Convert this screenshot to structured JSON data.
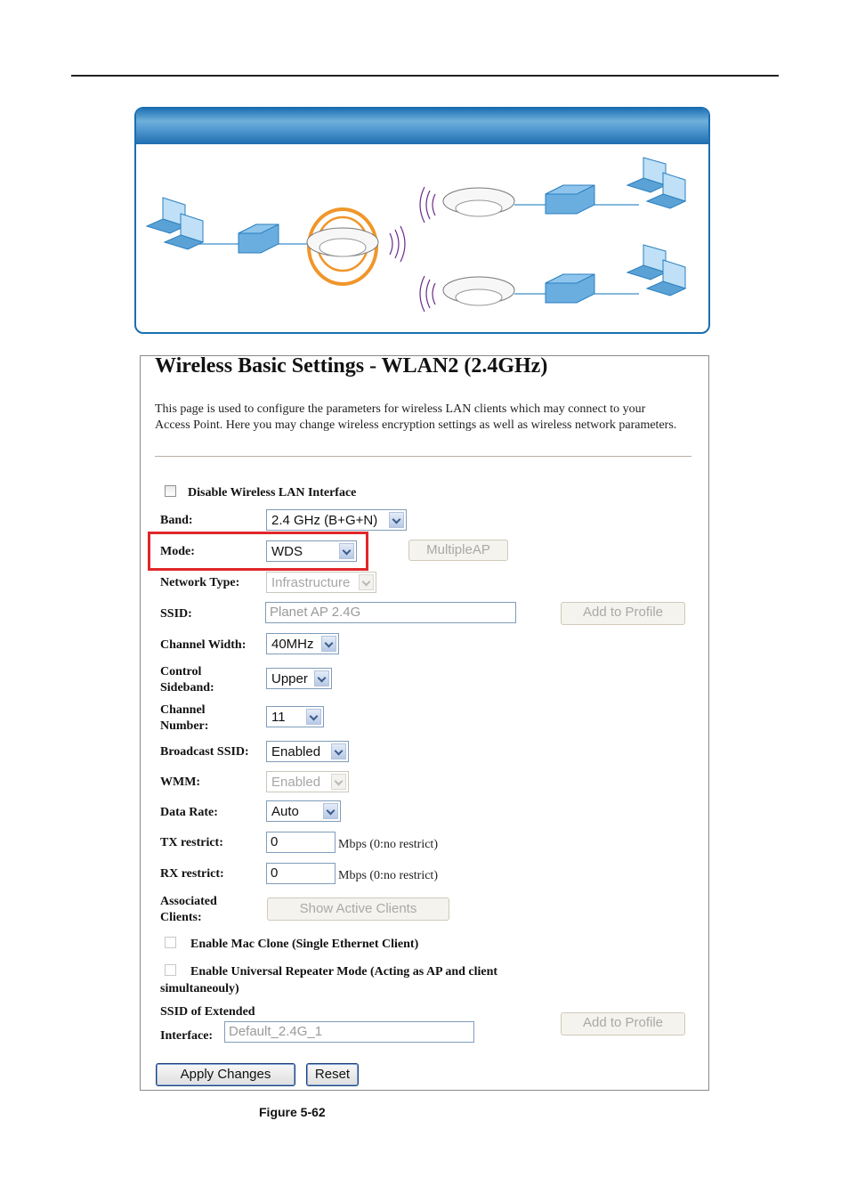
{
  "diagram": {
    "description": "WDS topology: laptops - switch - central AP (highlighted) wirelessly linked to two remote APs, each with a switch and laptops",
    "accent_color": "#1f72b6",
    "highlight_color": "#f0962a"
  },
  "page": {
    "title": "Wireless Basic Settings - WLAN2 (2.4GHz)",
    "description": "This page is used to configure the parameters for wireless LAN clients which may connect to your Access Point. Here you may change wireless encryption settings as well as wireless network parameters."
  },
  "form": {
    "disable_wlan": {
      "label": "Disable Wireless LAN Interface",
      "checked": false
    },
    "band": {
      "label": "Band:",
      "value": "2.4 GHz (B+G+N)"
    },
    "mode": {
      "label": "Mode:",
      "value": "WDS",
      "multiple_ap_button": "MultipleAP"
    },
    "network_type": {
      "label": "Network Type:",
      "value": "Infrastructure"
    },
    "ssid": {
      "label": "SSID:",
      "value": "Planet AP 2.4G",
      "add_profile_button": "Add to Profile"
    },
    "channel_width": {
      "label": "Channel Width:",
      "value": "40MHz"
    },
    "control_sideband": {
      "label_line1": "Control",
      "label_line2": "Sideband:",
      "value": "Upper"
    },
    "channel_number": {
      "label_line1": "Channel",
      "label_line2": "Number:",
      "value": "11"
    },
    "broadcast_ssid": {
      "label": "Broadcast SSID:",
      "value": "Enabled"
    },
    "wmm": {
      "label": "WMM:",
      "value": "Enabled"
    },
    "data_rate": {
      "label": "Data Rate:",
      "value": "Auto"
    },
    "tx_restrict": {
      "label": "TX restrict:",
      "value": "0",
      "note": "Mbps (0:no restrict)"
    },
    "rx_restrict": {
      "label": "RX restrict:",
      "value": "0",
      "note": "Mbps (0:no restrict)"
    },
    "associated_clients": {
      "label_line1": "Associated",
      "label_line2": "Clients:",
      "button": "Show Active Clients"
    },
    "mac_clone": {
      "label": "Enable Mac Clone (Single Ethernet Client)",
      "checked": false
    },
    "universal_repeater": {
      "label_line1": "Enable Universal Repeater Mode (Acting as AP and client",
      "label_line2": "simultaneouly)",
      "checked": false
    },
    "extended_ssid": {
      "label_line1": "SSID of Extended",
      "label_line2": "Interface:",
      "value": "Default_2.4G_1",
      "add_profile_button": "Add to Profile"
    },
    "apply_button": "Apply Changes",
    "reset_button": "Reset"
  },
  "highlight": {
    "target": "mode",
    "color": "#e0262a"
  },
  "caption": "Figure 5-62"
}
